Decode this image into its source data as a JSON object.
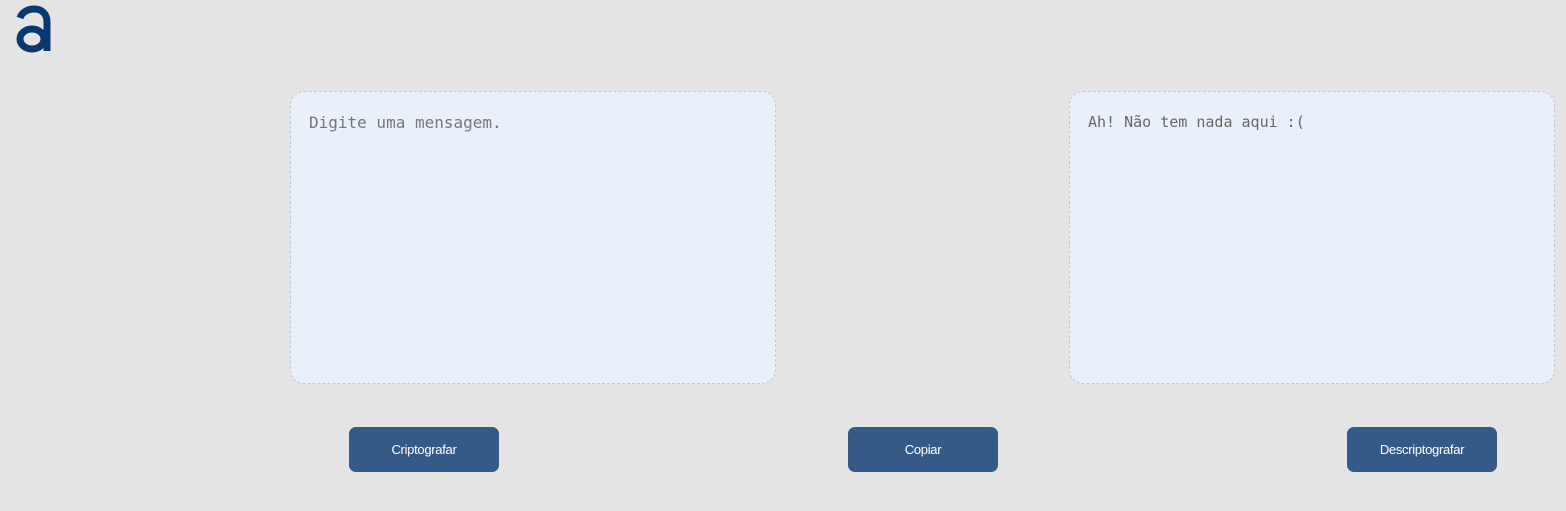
{
  "logo": {
    "icon": "alura-a-logo-icon",
    "color": "#0a3871"
  },
  "input": {
    "placeholder": "Digite uma mensagem.",
    "value": ""
  },
  "output": {
    "message": "Ah! Não tem nada aqui :("
  },
  "buttons": {
    "encrypt_label": "Criptografar",
    "copy_label": "Copiar",
    "decrypt_label": "Descriptografar"
  },
  "colors": {
    "background": "#e4e4e4",
    "panel": "#eaf0fa",
    "button": "#365a88",
    "button_text": "#ffffff"
  }
}
